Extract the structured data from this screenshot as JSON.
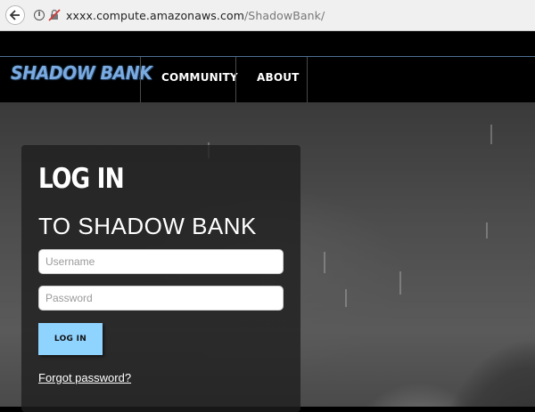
{
  "browser": {
    "url_host": "xxxx.compute.amazonaws.com",
    "url_path": "/ShadowBank/",
    "info_icon_glyph": "i"
  },
  "header": {
    "logo_text": "SHADOW BANK",
    "nav": [
      {
        "label": "COMMUNITY"
      },
      {
        "label": "ABOUT"
      }
    ]
  },
  "login": {
    "title": "LOG IN",
    "subtitle": "TO SHADOW BANK",
    "username_placeholder": "Username",
    "password_placeholder": "Password",
    "button_label": "LOG IN",
    "forgot_label": "Forgot password?"
  },
  "colors": {
    "accent_button": "#8fd3ff",
    "logo": "#7aaadf",
    "header_bg": "#000000"
  }
}
